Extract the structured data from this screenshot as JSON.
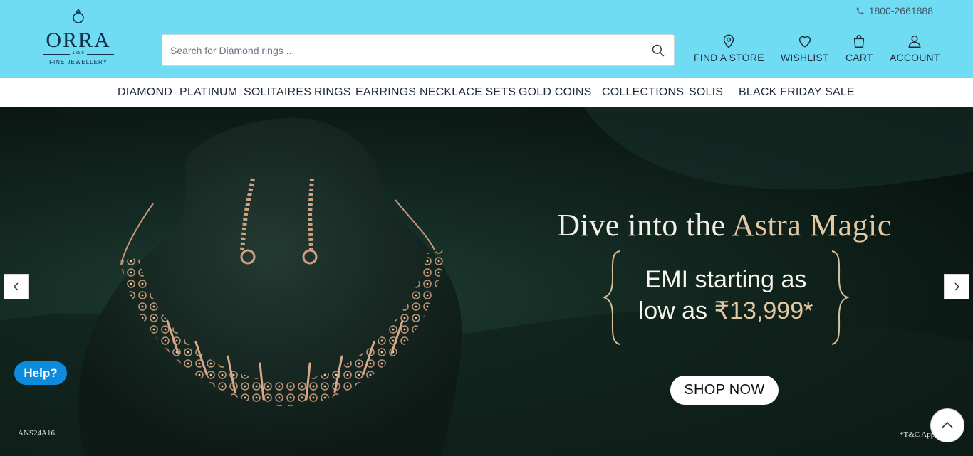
{
  "header": {
    "phone": "1800-2661888",
    "logo": {
      "wordmark": "ORRA",
      "year": "1888",
      "tagline": "FINE JEWELLERY"
    },
    "search": {
      "placeholder": "Search for Diamond rings ...",
      "value": ""
    },
    "nav": [
      {
        "label": "FIND A STORE",
        "icon": "map-pin-icon"
      },
      {
        "label": "WISHLIST",
        "icon": "heart-icon"
      },
      {
        "label": "CART",
        "icon": "shopping-bag-icon"
      },
      {
        "label": "ACCOUNT",
        "icon": "user-icon"
      }
    ]
  },
  "menu": [
    "DIAMOND",
    "PLATINUM",
    "SOLITAIRES",
    "RINGS",
    "EARRINGS",
    "NECKLACE SETS",
    "GOLD COINS",
    "COLLECTIONS",
    "SOLIS",
    "BLACK FRIDAY SALE"
  ],
  "hero": {
    "headline_plain": "Dive into the ",
    "headline_accent": "Astra Magic",
    "emi_line1": "EMI starting as",
    "emi_line2_plain": "low as ",
    "emi_line2_price": "₹13,999*",
    "cta": "SHOP NOW",
    "product_code": "ANS24A16",
    "terms": "*T&C App",
    "prev_icon": "chevron-left-icon",
    "next_icon": "chevron-right-icon"
  },
  "widgets": {
    "help": "Help?",
    "scroll_top_icon": "chevron-up-icon"
  },
  "colors": {
    "header_bg": "#6fdcf4",
    "gold_accent": "#e3c9a3",
    "help_blue": "#0d8bdc",
    "hero_dark": "#0b1713"
  }
}
